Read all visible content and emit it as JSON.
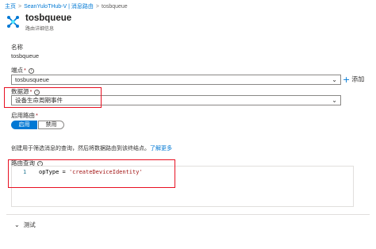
{
  "breadcrumb": {
    "items": [
      "主页",
      "SeanYuloTHub-V | 消息路由",
      "tosbqueue"
    ],
    "separator": ">"
  },
  "header": {
    "title": "tosbqueue",
    "subtitle": "路由详细信息"
  },
  "form": {
    "name_label": "名称",
    "name_value": "tosbqueue",
    "endpoint_label": "端点",
    "endpoint_value": "tosbusqueue",
    "add_label": "添加",
    "data_source_label": "数据源",
    "data_source_value": "设备生命周期事件",
    "enable_route_label": "启用路由",
    "enable_option": "启用",
    "disable_option": "禁用",
    "description": "创建用于筛选消息的查询，然后将数据路由到该终结点。",
    "learn_more": "了解更多",
    "route_query_label": "路由查询"
  },
  "editor": {
    "line_number": "1",
    "code_prefix": "opType = ",
    "code_string": "'createDeviceIdentity'"
  },
  "test": {
    "label": "测试"
  },
  "colors": {
    "accent": "#0078d4",
    "highlight": "#e81123",
    "required": "#a4262c"
  },
  "icons": [
    "iot-hub-icon",
    "info-icon",
    "chevron-down-icon",
    "plus-icon"
  ]
}
